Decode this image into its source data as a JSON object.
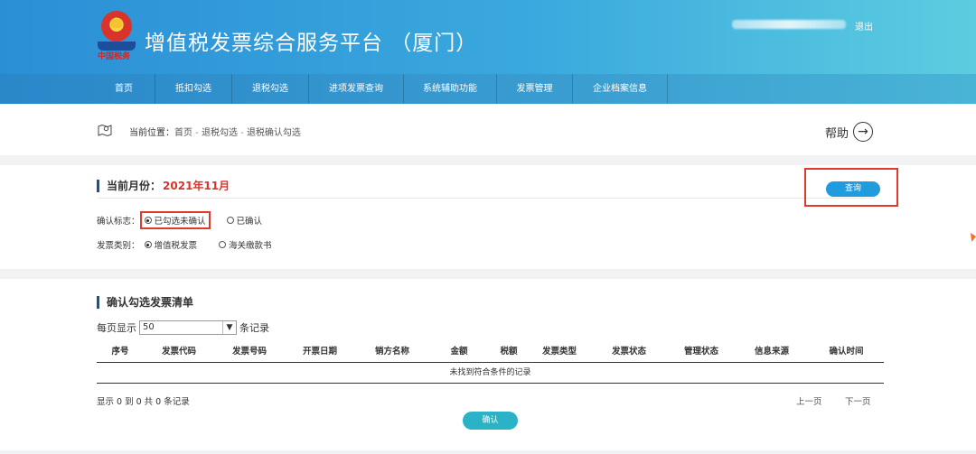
{
  "header": {
    "seal_text": "中国税务",
    "title": "增值税发票综合服务平台 （厦门）",
    "logout": "退出",
    "accent_color": "#2b8fd6"
  },
  "nav": [
    {
      "label": "首页"
    },
    {
      "label": "抵扣勾选"
    },
    {
      "label": "退税勾选"
    },
    {
      "label": "进项发票查询"
    },
    {
      "label": "系统辅助功能"
    },
    {
      "label": "发票管理"
    },
    {
      "label": "企业档案信息"
    }
  ],
  "breadcrumb": {
    "label": "当前位置：",
    "home": "首页",
    "separator": " - ",
    "level1": "退税勾选",
    "level2": "退税确认勾选"
  },
  "help": {
    "label": "帮助",
    "icon": "arrow-right-circle-icon"
  },
  "filter": {
    "month_label": "当前月份：",
    "month_value": "2021年11月",
    "query_button": "查询",
    "confirm_flag_label": "确认标志：",
    "confirm_options": [
      "已勾选未确认",
      "已确认"
    ],
    "confirm_selected": 0,
    "invoice_type_label": "发票类别：",
    "invoice_type_options": [
      "增值税发票",
      "海关缴款书"
    ],
    "invoice_type_selected": 0
  },
  "list": {
    "title": "确认勾选发票清单",
    "page_size_prefix": "每页显示",
    "page_size_value": "50",
    "page_size_suffix": "条记录",
    "columns": [
      "序号",
      "发票代码",
      "发票号码",
      "开票日期",
      "销方名称",
      "金额",
      "税额",
      "发票类型",
      "发票状态",
      "管理状态",
      "信息来源",
      "确认时间"
    ],
    "empty_text": "未找到符合条件的记录",
    "summary": "显示 0 到 0 共 0 条记录",
    "prev_page": "上一页",
    "next_page": "下一页",
    "confirm_button": "确认"
  }
}
